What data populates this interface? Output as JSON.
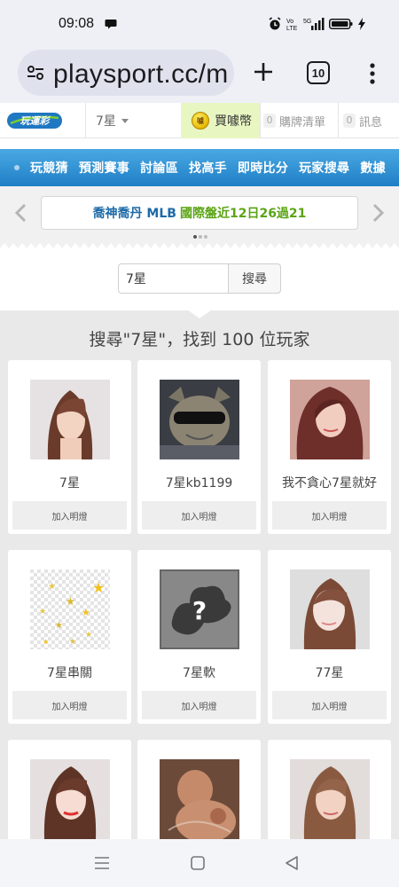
{
  "status_bar": {
    "time": "09:08"
  },
  "browser": {
    "url": "playsport.cc/m",
    "tab_count": "10"
  },
  "header": {
    "logo_alt": "玩運彩",
    "search_type": "7星",
    "buy_coins": "買噱幣",
    "cart_count": "0",
    "cart_label": "購牌清單",
    "msg_count": "0",
    "msg_label": "訊息"
  },
  "nav": {
    "items": [
      "玩競猜",
      "預測賽事",
      "討論區",
      "找高手",
      "即時比分",
      "玩家搜尋",
      "數據"
    ]
  },
  "marquee": {
    "blue_text": "喬神喬丹 MLB",
    "green_text": "國際盤近12日26過21"
  },
  "search": {
    "value": "7星",
    "button_label": "搜尋"
  },
  "results": {
    "title": "搜尋\"7星\"，找到 100 位玩家",
    "players": [
      {
        "name": "7星",
        "follow_label": "加入明燈",
        "avatar": "woman-photo"
      },
      {
        "name": "7星kb1199",
        "follow_label": "加入明燈",
        "avatar": "cat-sunglasses"
      },
      {
        "name": "我不貪心7星就好",
        "follow_label": "加入明燈",
        "avatar": "woman-photo"
      },
      {
        "name": "7星串關",
        "follow_label": "加入明燈",
        "avatar": "stars-pattern"
      },
      {
        "name": "7星軟",
        "follow_label": "加入明燈",
        "avatar": "default-question"
      },
      {
        "name": "77星",
        "follow_label": "加入明燈",
        "avatar": "woman-photo"
      },
      {
        "name": "",
        "follow_label": "",
        "avatar": "woman-photo"
      },
      {
        "name": "",
        "follow_label": "",
        "avatar": "person-photo"
      },
      {
        "name": "",
        "follow_label": "",
        "avatar": "woman-photo"
      }
    ]
  },
  "colors": {
    "nav_blue": "#2a8ad0",
    "coin_bg": "#e8f7c2",
    "marquee_blue": "#1d6aa8",
    "marquee_green": "#5aa415"
  }
}
